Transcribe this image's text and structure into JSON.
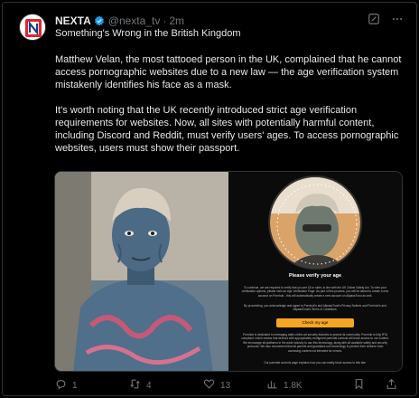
{
  "author": {
    "name": "NEXTA",
    "handle": "@nexta_tv",
    "separator": "·",
    "time": "2m"
  },
  "tweet": {
    "headline": "Something's Wrong in the British Kingdom",
    "paragraph1": "Matthew Velan, the most tattooed person in the UK, complained that he cannot access pornographic websites due to a new law — the age verification system mistakenly identifies his face as a mask.",
    "paragraph2": "It's worth noting that the UK recently introduced strict age verification requirements for websites. Now, all sites with potentially harmful content, including Discord and Reddit, must verify users' ages. To access pornographic websites, users must show their passport."
  },
  "media": {
    "verify_title": "Please verify your age",
    "verify_text1": "To continue, we are required to verify that you are 18 or older, in line with the UK Online Safety Act. To view your verification options, please visit our Age Verification Page. As part of this process, you will be asked to create a new account on Pornhub - this will automatically create a new account on AllpassTrust as well.",
    "verify_text2": "By proceeding, you acknowledge and agree to Pornhub's and AllpassTrust's Privacy Notices and Pornhub's and AllpassTrust's Terms & Conditions.",
    "verify_button": "Check my age",
    "verify_text3": "Pornhub is dedicated to leveraging state-of-the-art security features to protect its community. Pornhub is fully RTA compliant, which means that devices with appropriately configured parental controls will block access to our content. We encourage all platforms in the adult industry to use this technology, along with all available safety and security protocols. We also recommend that all parents and guardians use technology to prevent their children from accessing content not intended for minors.",
    "verify_text4": "Our parental controls page explains how you can easily block access to this site."
  },
  "actions": {
    "replies": "1",
    "retweets": "4",
    "likes": "13",
    "views": "1.8K"
  },
  "colors": {
    "background": "#000000",
    "text": "#e7e9ea",
    "muted": "#71767b",
    "verified": "#1d9bf0",
    "button": "#f5a623"
  },
  "icons": [
    "nexta-logo-icon",
    "verified-badge-icon",
    "grok-icon",
    "more-icon",
    "reply-icon",
    "retweet-icon",
    "like-icon",
    "views-icon",
    "bookmark-icon",
    "share-icon"
  ]
}
